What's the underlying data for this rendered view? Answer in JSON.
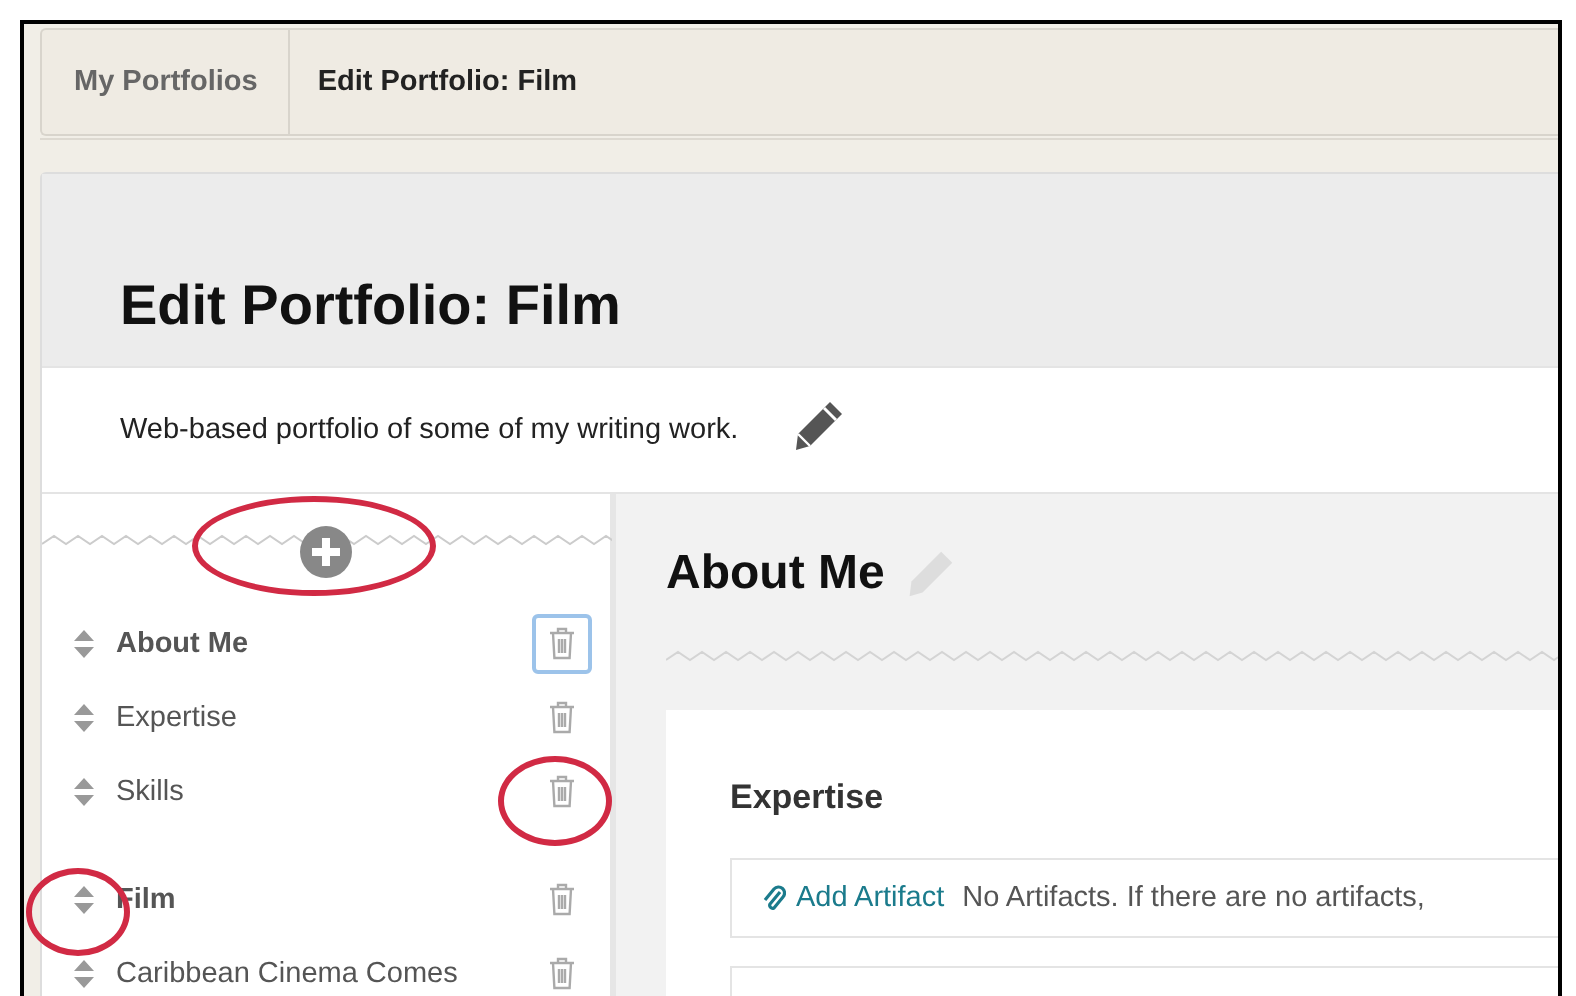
{
  "breadcrumbs": [
    {
      "label": "My Portfolios",
      "current": false
    },
    {
      "label": "Edit Portfolio: Film",
      "current": true
    }
  ],
  "portfolio": {
    "title": "Edit Portfolio: Film",
    "description": "Web-based portfolio of some of my writing work."
  },
  "sidebar": {
    "pages": [
      {
        "label": "About Me",
        "delete_focused": true,
        "children": [
          {
            "label": "Expertise",
            "delete_focused": false
          },
          {
            "label": "Skills",
            "delete_focused": false
          }
        ]
      },
      {
        "label": "Film",
        "delete_focused": false,
        "children": [
          {
            "label": "Caribbean Cinema Comes",
            "delete_focused": false
          }
        ]
      }
    ]
  },
  "page": {
    "title": "About Me",
    "sections": [
      {
        "title": "Expertise",
        "add_link": "Add Artifact",
        "empty_text": "No Artifacts. If there are no artifacts,"
      }
    ]
  }
}
